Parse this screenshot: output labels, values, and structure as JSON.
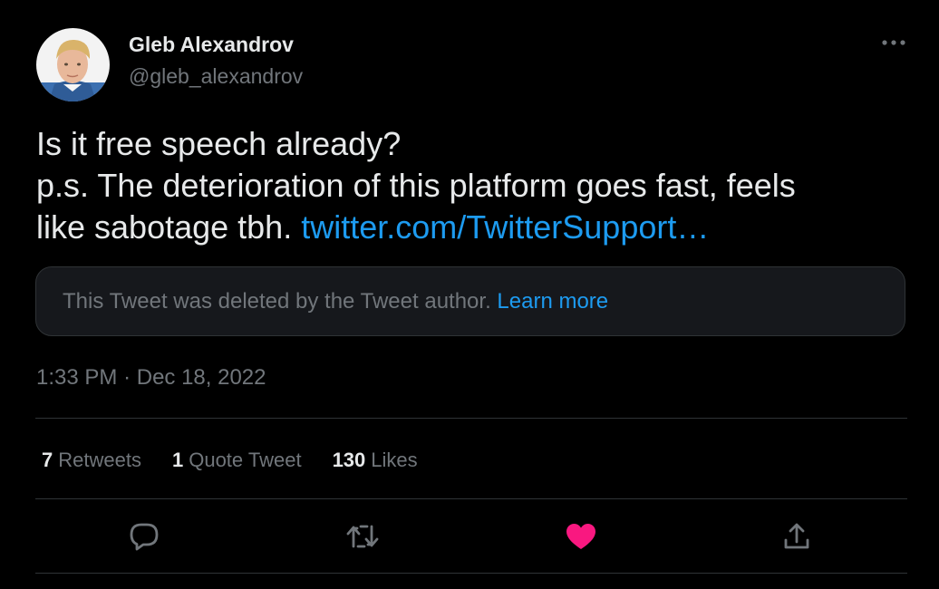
{
  "author": {
    "name": "Gleb Alexandrov",
    "handle": "@gleb_alexandrov",
    "avatar_icon": "profile-photo"
  },
  "tweet": {
    "line1": "Is it free speech already?",
    "line2": "p.s. The deterioration of this platform goes fast, feels",
    "line3_text": "like sabotage tbh.",
    "link_text": "twitter.com/TwitterSupport…"
  },
  "quoted": {
    "message": "This Tweet was deleted by the Tweet author.",
    "learn_more": "Learn more"
  },
  "meta": {
    "time": "1:33 PM",
    "separator": "·",
    "date": "Dec 18, 2022"
  },
  "stats": {
    "retweets_count": "7",
    "retweets_label": "Retweets",
    "quotes_count": "1",
    "quotes_label": "Quote Tweet",
    "likes_count": "130",
    "likes_label": "Likes"
  },
  "actions": [
    {
      "icon": "reply-icon"
    },
    {
      "icon": "retweet-icon"
    },
    {
      "icon": "like-icon",
      "active": true
    },
    {
      "icon": "share-icon"
    }
  ],
  "colors": {
    "background": "#000000",
    "text": "#e7e9ea",
    "secondary": "#71767b",
    "link": "#1d9bf0",
    "like": "#f91880",
    "border": "#2f3336"
  }
}
